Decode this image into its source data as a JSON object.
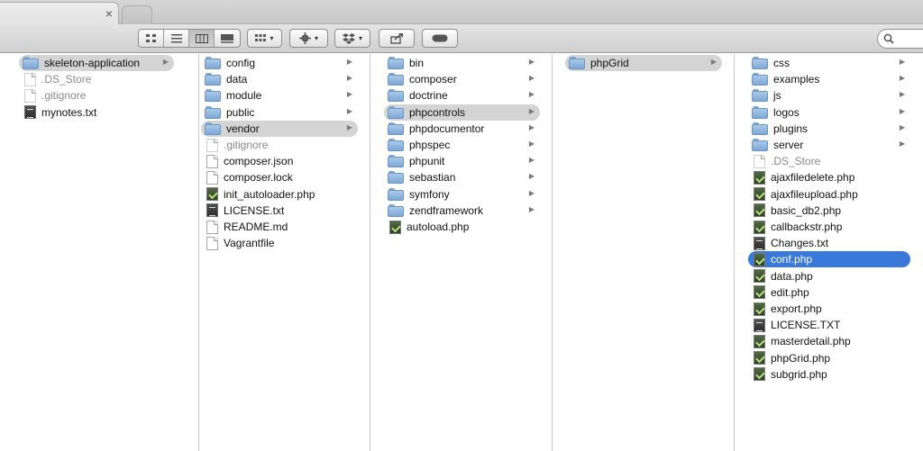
{
  "tabs": {
    "close_glyph": "×"
  },
  "toolbar": {
    "view_buttons": [
      "icon-view",
      "list-view",
      "column-view",
      "cover-flow-view"
    ],
    "active_view_index": 2,
    "arrange_icon": "arrange-icon",
    "action_icon": "gear-icon",
    "dropbox_icon": "dropbox-icon",
    "share_icon": "share-icon",
    "tag_icon": "tag-icon",
    "caret": "▾",
    "search_icon": "search-icon"
  },
  "colors": {
    "selection_blue": "#3879d9",
    "selection_gray": "#d4d4d4",
    "folder_blue": "#7ea7d4"
  },
  "columns": [
    {
      "items": [
        {
          "name": "skeleton-application",
          "kind": "folder",
          "state": "path",
          "arrow": true
        },
        {
          "name": ".DS_Store",
          "kind": "hidden"
        },
        {
          "name": ".gitignore",
          "kind": "hidden"
        },
        {
          "name": "mynotes.txt",
          "kind": "txt"
        }
      ]
    },
    {
      "items": [
        {
          "name": "config",
          "kind": "folder",
          "arrow": true
        },
        {
          "name": "data",
          "kind": "folder",
          "arrow": true
        },
        {
          "name": "module",
          "kind": "folder",
          "arrow": true
        },
        {
          "name": "public",
          "kind": "folder",
          "arrow": true
        },
        {
          "name": "vendor",
          "kind": "folder",
          "state": "path",
          "arrow": true
        },
        {
          "name": ".gitignore",
          "kind": "hidden"
        },
        {
          "name": "composer.json",
          "kind": "doc"
        },
        {
          "name": "composer.lock",
          "kind": "doc"
        },
        {
          "name": "init_autoloader.php",
          "kind": "php"
        },
        {
          "name": "LICENSE.txt",
          "kind": "txt"
        },
        {
          "name": "README.md",
          "kind": "doc"
        },
        {
          "name": "Vagrantfile",
          "kind": "doc"
        }
      ]
    },
    {
      "items": [
        {
          "name": "bin",
          "kind": "folder",
          "arrow": true
        },
        {
          "name": "composer",
          "kind": "folder",
          "arrow": true
        },
        {
          "name": "doctrine",
          "kind": "folder",
          "arrow": true
        },
        {
          "name": "phpcontrols",
          "kind": "folder",
          "state": "path",
          "arrow": true
        },
        {
          "name": "phpdocumentor",
          "kind": "folder",
          "arrow": true
        },
        {
          "name": "phpspec",
          "kind": "folder",
          "arrow": true
        },
        {
          "name": "phpunit",
          "kind": "folder",
          "arrow": true
        },
        {
          "name": "sebastian",
          "kind": "folder",
          "arrow": true
        },
        {
          "name": "symfony",
          "kind": "folder",
          "arrow": true
        },
        {
          "name": "zendframework",
          "kind": "folder",
          "arrow": true
        },
        {
          "name": "autoload.php",
          "kind": "php"
        }
      ]
    },
    {
      "items": [
        {
          "name": "phpGrid",
          "kind": "folder",
          "state": "path",
          "arrow": true
        }
      ]
    },
    {
      "items": [
        {
          "name": "css",
          "kind": "folder",
          "arrow": true
        },
        {
          "name": "examples",
          "kind": "folder",
          "arrow": true
        },
        {
          "name": "js",
          "kind": "folder",
          "arrow": true
        },
        {
          "name": "logos",
          "kind": "folder",
          "arrow": true
        },
        {
          "name": "plugins",
          "kind": "folder",
          "arrow": true
        },
        {
          "name": "server",
          "kind": "folder",
          "arrow": true
        },
        {
          "name": ".DS_Store",
          "kind": "hidden"
        },
        {
          "name": "ajaxfiledelete.php",
          "kind": "php"
        },
        {
          "name": "ajaxfileupload.php",
          "kind": "php"
        },
        {
          "name": "basic_db2.php",
          "kind": "php"
        },
        {
          "name": "callbackstr.php",
          "kind": "php"
        },
        {
          "name": "Changes.txt",
          "kind": "txt"
        },
        {
          "name": "conf.php",
          "kind": "php",
          "state": "selected"
        },
        {
          "name": "data.php",
          "kind": "php"
        },
        {
          "name": "edit.php",
          "kind": "php"
        },
        {
          "name": "export.php",
          "kind": "php"
        },
        {
          "name": "LICENSE.TXT",
          "kind": "txt"
        },
        {
          "name": "masterdetail.php",
          "kind": "php"
        },
        {
          "name": "phpGrid.php",
          "kind": "php"
        },
        {
          "name": "subgrid.php",
          "kind": "php"
        }
      ]
    }
  ]
}
